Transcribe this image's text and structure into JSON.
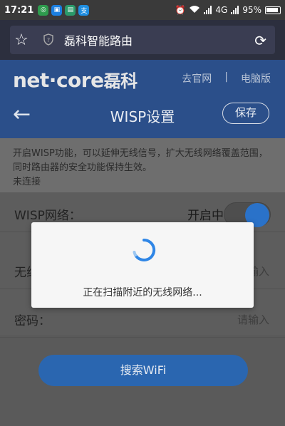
{
  "status_bar": {
    "time": "17:21",
    "network": "4G",
    "battery": "95%"
  },
  "browser": {
    "url_title": "磊科智能路由"
  },
  "header": {
    "logo_text": "net·core",
    "logo_cn": "磊科",
    "links": [
      "去官网",
      "电脑版"
    ],
    "separator": "|",
    "page_title": "WISP设置",
    "save_label": "保存",
    "back_glyph": "←"
  },
  "description": {
    "text": "开启WISP功能，可以延伸无线信号，扩大无线网络覆盖范围，同时路由器的安全功能保持生效。",
    "connection_status": "未连接"
  },
  "form": {
    "wisp_label": "WISP网络：",
    "wisp_state": "开启中",
    "wisp_enabled": true,
    "ssid_label": "无线",
    "ssid_placeholder": "输入",
    "password_label": "密码：",
    "password_placeholder": "请输入"
  },
  "search_wifi_label": "搜索WiFi",
  "dialog": {
    "message": "正在扫描附近的无线网络..."
  },
  "colors": {
    "header_blue": "#2b4f8a",
    "accent_blue": "#2a72c9",
    "spinner_blue": "#2f86e6"
  }
}
